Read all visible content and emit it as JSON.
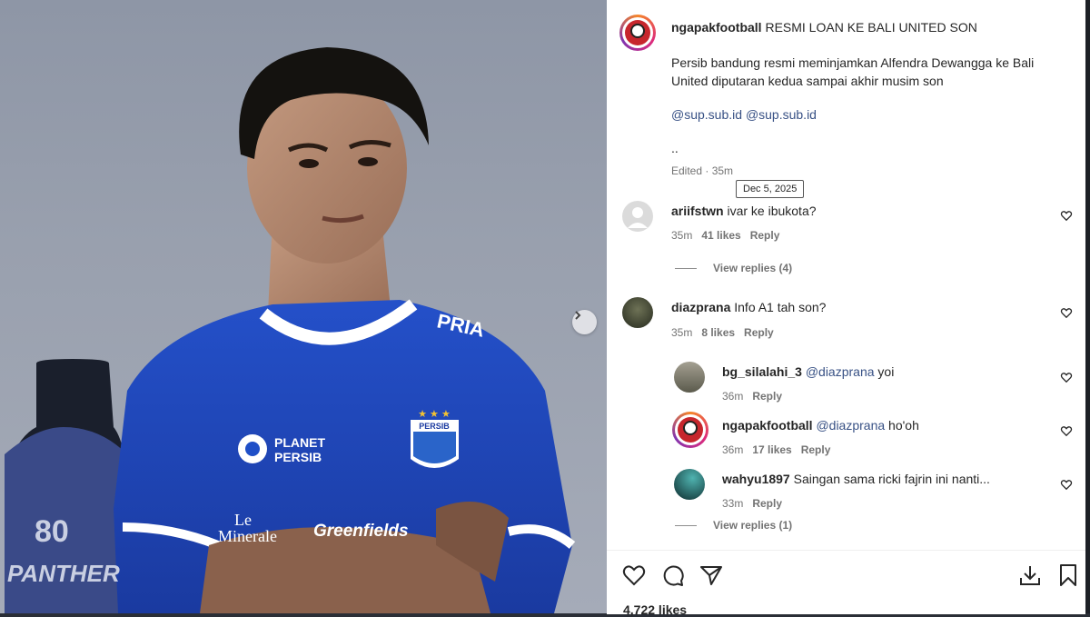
{
  "post": {
    "author": "ngapakfootball",
    "headline": "RESMI LOAN KE BALI UNITED SON",
    "body_line1": "Persib bandung resmi meminjamkan Alfendra Dewangga ke Bali",
    "body_line2": "United diputaran kedua sampai akhir musim son",
    "mention1": "@sup.sub.id",
    "mention2": "@sup.sub.id",
    "dots": "..",
    "edited": "Edited · 35m",
    "tooltip": "Dec 5, 2025"
  },
  "photo": {
    "jersey_brand": "PERSIB",
    "sponsor1": "PLANET",
    "sponsor1b": "PERSIB",
    "sponsor2": "Le",
    "sponsor2b": "Minerale",
    "sponsor3": "Greenfields",
    "collar": "PRIA",
    "bottle_number": "80",
    "bottle_text": "PANTHER"
  },
  "comments": [
    {
      "user": "ariifstwn",
      "text": "ivar ke ibukota?",
      "time": "35m",
      "likes": "41 likes",
      "reply": "Reply",
      "view_replies": "View replies (4)"
    },
    {
      "user": "diazprana",
      "text": "Info A1 tah son?",
      "time": "35m",
      "likes": "8 likes",
      "reply": "Reply"
    }
  ],
  "replies": [
    {
      "user": "bg_silalahi_3",
      "mention": "@diazprana",
      "text": "yoi",
      "time": "36m",
      "likes": "",
      "reply": "Reply"
    },
    {
      "user": "ngapakfootball",
      "mention": "@diazprana",
      "text": "ho'oh",
      "time": "36m",
      "likes": "17 likes",
      "reply": "Reply"
    },
    {
      "user": "wahyu1897",
      "mention": "",
      "text": "Saingan sama ricki fajrin ini nanti...",
      "time": "33m",
      "likes": "",
      "reply": "Reply"
    }
  ],
  "view_replies_2": "View replies (1)",
  "likes_count": "4,722 likes",
  "icons": [
    "heart-icon",
    "comment-icon",
    "share-icon",
    "save-download-icon",
    "bookmark-icon",
    "chevron-right-icon"
  ],
  "colors": {
    "mention": "#385185",
    "jersey": "#1f4fc7",
    "text": "#262626",
    "muted": "#737373"
  }
}
